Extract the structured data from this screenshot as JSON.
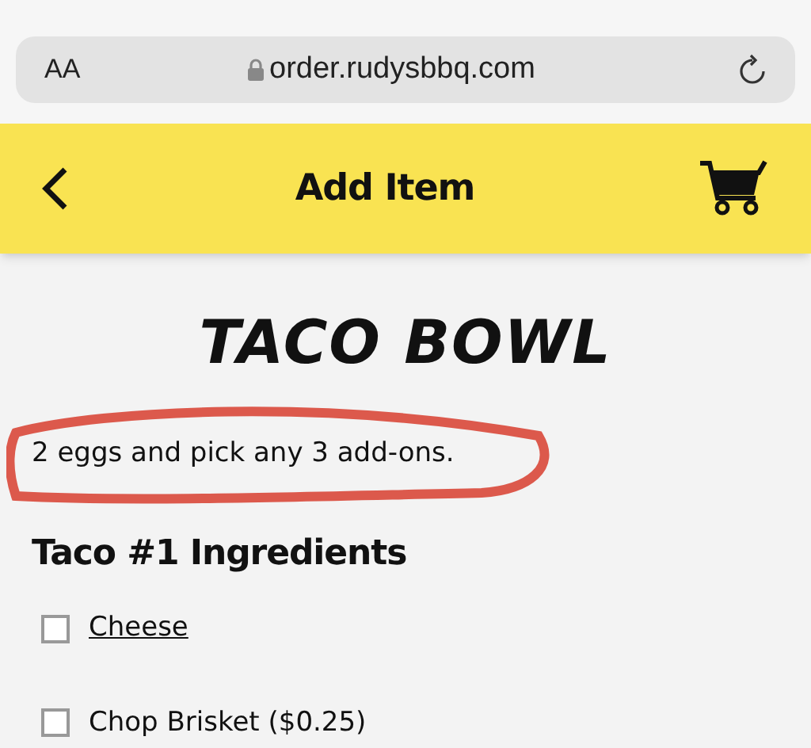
{
  "browser": {
    "text_size_button": "AA",
    "url": "order.rudysbbq.com"
  },
  "header": {
    "title": "Add Item"
  },
  "item": {
    "title": "TACO BOWL",
    "description": "2 eggs and pick any 3 add-ons.",
    "description_circled": true
  },
  "section": {
    "title": "Taco #1 Ingredients"
  },
  "options": [
    {
      "label": "Cheese",
      "kind": "link",
      "checked": false
    },
    {
      "label": "Chop Brisket ($0.25)",
      "kind": "plain",
      "checked": false
    }
  ]
}
